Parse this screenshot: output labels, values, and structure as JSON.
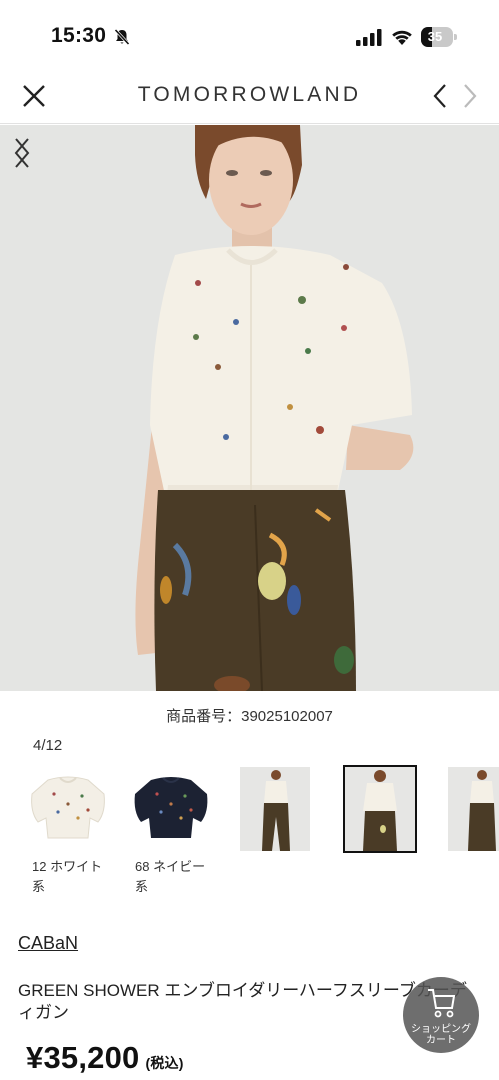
{
  "status_bar": {
    "time": "15:30",
    "battery": "35",
    "battery_level": 0.35,
    "icons": [
      "bell-slash-icon",
      "cellular-signal-icon",
      "wifi-icon",
      "battery-icon"
    ]
  },
  "header": {
    "brand": "TOMORROWLAND",
    "icons": [
      "close-icon",
      "chevron-left-icon",
      "chevron-right-icon"
    ]
  },
  "gallery": {
    "product_number": "商品番号：39025102007",
    "counter": "4/12",
    "icons": [
      "chevron-left-icon",
      "chevron-right-icon"
    ]
  },
  "color_options": [
    {
      "label_line1": "12 ホワイト",
      "label_line2": "系",
      "color": "#f3efe6"
    },
    {
      "label_line1": "68 ネイビー",
      "label_line2": "系",
      "color": "#1c2233"
    }
  ],
  "product": {
    "brand_link": "CABaN",
    "name": "GREEN SHOWER エンブロイダリーハーフスリーブカーディガン",
    "price": "¥35,200",
    "tax_note": "(税込)"
  },
  "cart_button": {
    "label_line1": "ショッピング",
    "label_line2": "カート",
    "icon": "cart-icon"
  },
  "colors": {
    "background": "#ffffff",
    "photo_background": "#e4e5e3",
    "cardigan": "#f4f0e6",
    "trousers": "#4a3b26"
  }
}
